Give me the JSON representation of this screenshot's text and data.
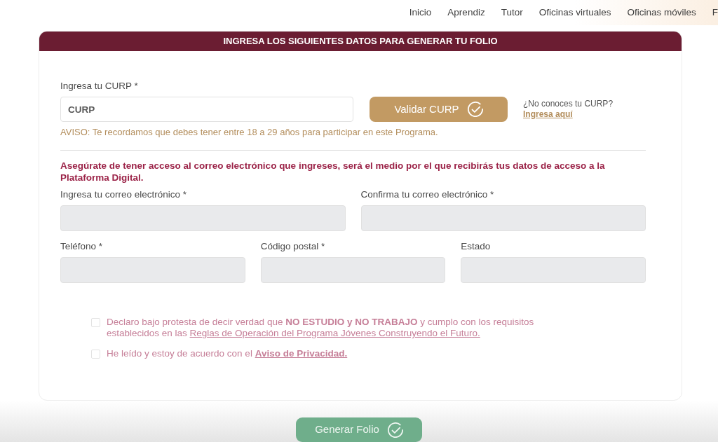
{
  "nav": {
    "items": [
      {
        "label": "Inicio"
      },
      {
        "label": "Aprendiz"
      },
      {
        "label": "Tutor"
      },
      {
        "label": "Oficinas virtuales"
      },
      {
        "label": "Oficinas móviles"
      },
      {
        "label": "F"
      }
    ]
  },
  "form": {
    "header": "INGRESA LOS SIGUIENTES DATOS PARA GENERAR TU FOLIO",
    "curp": {
      "label": "Ingresa tu CURP *",
      "placeholder": "CURP",
      "validate_button": "Validar CURP",
      "help_question": "¿No conoces tu CURP?",
      "help_link": "Ingresa aquí",
      "notice": "AVISO: Te recordamos que debes tener entre 18 a 29 años para participar en este Programa."
    },
    "email_notice": "Asegúrate de tener acceso al correo electrónico que ingreses, será el medio por el que recibirás tus datos de acceso a la Plataforma Digital.",
    "field_rows": [
      [
        {
          "label": "Ingresa tu correo electrónico *"
        },
        {
          "label": "Confirma tu correo electrónico *"
        }
      ],
      [
        {
          "label": "Teléfono *"
        },
        {
          "label": "Código postal *"
        },
        {
          "label": "Estado"
        }
      ]
    ],
    "checkboxes": [
      {
        "text": "Declaro bajo protesta de decir verdad que **NO ESTUDIO y NO TRABAJO** y cumplo con los requisitos establecidos en las ",
        "link": "Reglas de Operación del Programa Jóvenes Construyendo el Futuro.",
        "checked": false
      },
      {
        "text": "He leído y estoy de acuerdo con el ",
        "link": "**Aviso de Privacidad.**",
        "checked": false
      }
    ]
  },
  "submit_button": "Generar Folio"
}
